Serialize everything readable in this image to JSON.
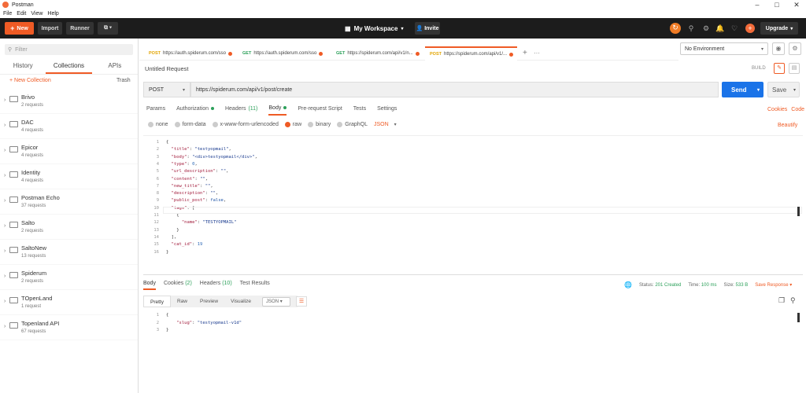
{
  "window": {
    "title": "Postman",
    "controls": [
      "–",
      "□",
      "✕"
    ]
  },
  "menu": [
    "File",
    "Edit",
    "View",
    "Help"
  ],
  "header": {
    "new_label": "New",
    "import_label": "Import",
    "runner_label": "Runner",
    "workspace_label": "My Workspace",
    "invite_label": "Invite",
    "upgrade_label": "Upgrade"
  },
  "sidebar": {
    "filter_placeholder": "Filter",
    "tabs": [
      "History",
      "Collections",
      "APIs"
    ],
    "new_collection": "+ New Collection",
    "trash": "Trash",
    "collections": [
      {
        "name": "Brivo",
        "requests": "2 requests"
      },
      {
        "name": "DAC",
        "requests": "4 requests"
      },
      {
        "name": "Epicor",
        "requests": "4 requests"
      },
      {
        "name": "Identity",
        "requests": "4 requests"
      },
      {
        "name": "Postman Echo",
        "requests": "37 requests"
      },
      {
        "name": "Salto",
        "requests": "2 requests"
      },
      {
        "name": "SaltoNew",
        "requests": "13 requests"
      },
      {
        "name": "Spiderum",
        "requests": "2 requests"
      },
      {
        "name": "TOpenLand",
        "requests": "1 request"
      },
      {
        "name": "Topenland API",
        "requests": "67 requests"
      }
    ]
  },
  "request_tabs": [
    {
      "method": "POST",
      "url": "https://auth.spiderum.com/sso",
      "method_color": "#e2a400"
    },
    {
      "method": "GET",
      "url": "https://auth.spiderum.com/sso",
      "method_color": "#2ca05a"
    },
    {
      "method": "GET",
      "url": "https://spiderum.com/api/v1/n...",
      "method_color": "#2ca05a"
    },
    {
      "method": "POST",
      "url": "https://spiderum.com/api/v1/...",
      "method_color": "#e2a400"
    }
  ],
  "environment": "No Environment",
  "request": {
    "name": "Untitled Request",
    "build_label": "BUILD",
    "method": "POST",
    "url": "https://spiderum.com/api/v1/post/create",
    "send_label": "Send",
    "save_label": "Save",
    "subtabs": [
      "Params",
      "Authorization",
      "Headers",
      "Body",
      "Pre-request Script",
      "Tests",
      "Settings"
    ],
    "headers_count": "(11)",
    "cookies_label": "Cookies",
    "code_label": "Code",
    "body_types": [
      "none",
      "form-data",
      "x-www-form-urlencoded",
      "raw",
      "binary",
      "GraphQL"
    ],
    "body_format": "JSON",
    "beautify_label": "Beautify"
  },
  "body_lines": [
    "{",
    "  \"title\": \"testyopmail\",",
    "  \"body\": \"<div>testyopmail</div>\",",
    "  \"type\": 0,",
    "  \"url_description\": \"\",",
    "  \"content\": \"\",",
    "  \"new_title\": \"\",",
    "  \"description\": \"\",",
    "  \"public_post\": false,",
    "  \"tags\": [",
    "    {",
    "      \"name\": \"TESTYOPMAIL\"",
    "    }",
    "  ],",
    "  \"cat_id\": 19",
    "}"
  ],
  "response": {
    "tabs": [
      "Body",
      "Cookies",
      "Headers",
      "Test Results"
    ],
    "cookies_count": "(2)",
    "headers_count": "(10)",
    "status_label": "Status:",
    "status_value": "201 Created",
    "time_label": "Time:",
    "time_value": "100 ms",
    "size_label": "Size:",
    "size_value": "533 B",
    "save_response": "Save Response",
    "modes": [
      "Pretty",
      "Raw",
      "Preview",
      "Visualize"
    ],
    "format": "JSON",
    "lines": [
      "{",
      "    \"slug\": \"testyopmail-v1d\"",
      "}"
    ]
  },
  "colors": {
    "accent": "#ef5b25",
    "send": "#1a73e8",
    "ok": "#2ca05a"
  }
}
